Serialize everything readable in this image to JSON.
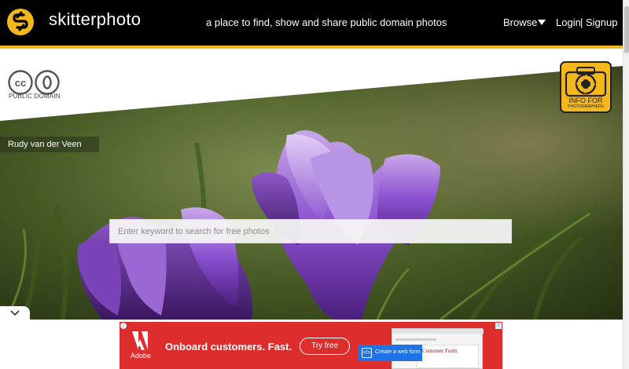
{
  "header": {
    "logo_text": "skitterphoto",
    "tagline": "a place to find, show and share public domain photos",
    "browse_label": "Browse",
    "login_label": "Login",
    "separator": "|",
    "signup_label": "Signup"
  },
  "license": {
    "label": "PUBLIC DOMAIN"
  },
  "info_badge": {
    "title": "INFO FOR",
    "subtitle": "PHOTOGRAPHERS"
  },
  "hero": {
    "photographer": "Rudy van der Veen",
    "search_placeholder": "Enter keyword to search for free photos"
  },
  "ad": {
    "brand": "Adobe",
    "headline": "Onboard customers. Fast.",
    "cta_label": "Try free",
    "form_cta": "Create a web form",
    "form_title": "Customer Form",
    "close_glyph": "✕",
    "info_glyph": "i"
  },
  "colors": {
    "brand_yellow": "#f5b81c",
    "topbar": "#000000",
    "ad_red": "#dd2d2d"
  }
}
